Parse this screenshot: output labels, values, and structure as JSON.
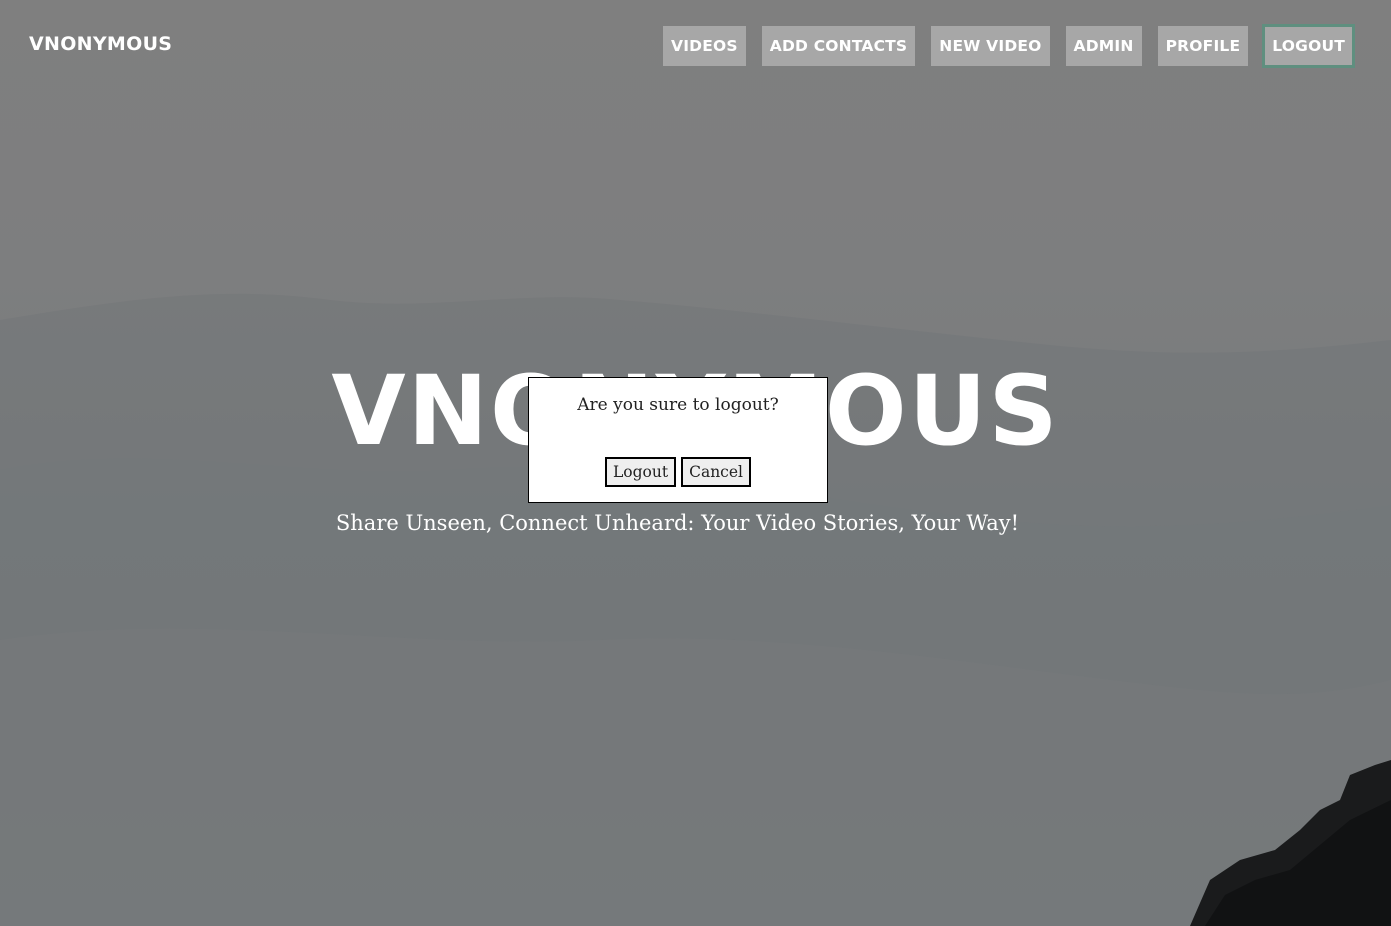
{
  "header": {
    "brand": "VNONYMOUS",
    "nav": [
      {
        "label": "VIDEOS"
      },
      {
        "label": "ADD CONTACTS"
      },
      {
        "label": "NEW VIDEO"
      },
      {
        "label": "ADMIN"
      },
      {
        "label": "PROFILE"
      },
      {
        "label": "LOGOUT"
      }
    ]
  },
  "hero": {
    "title": "VNONYMOUS",
    "subtitle": "Share Unseen, Connect Unheard: Your Video Stories, Your Way!"
  },
  "dialog": {
    "message": "Are you sure to logout?",
    "confirm_label": "Logout",
    "cancel_label": "Cancel"
  },
  "colors": {
    "nav_button_bg": "#a7a7a7",
    "active_outline": "#5f8f7f",
    "text_on_hero": "#ffffff"
  }
}
